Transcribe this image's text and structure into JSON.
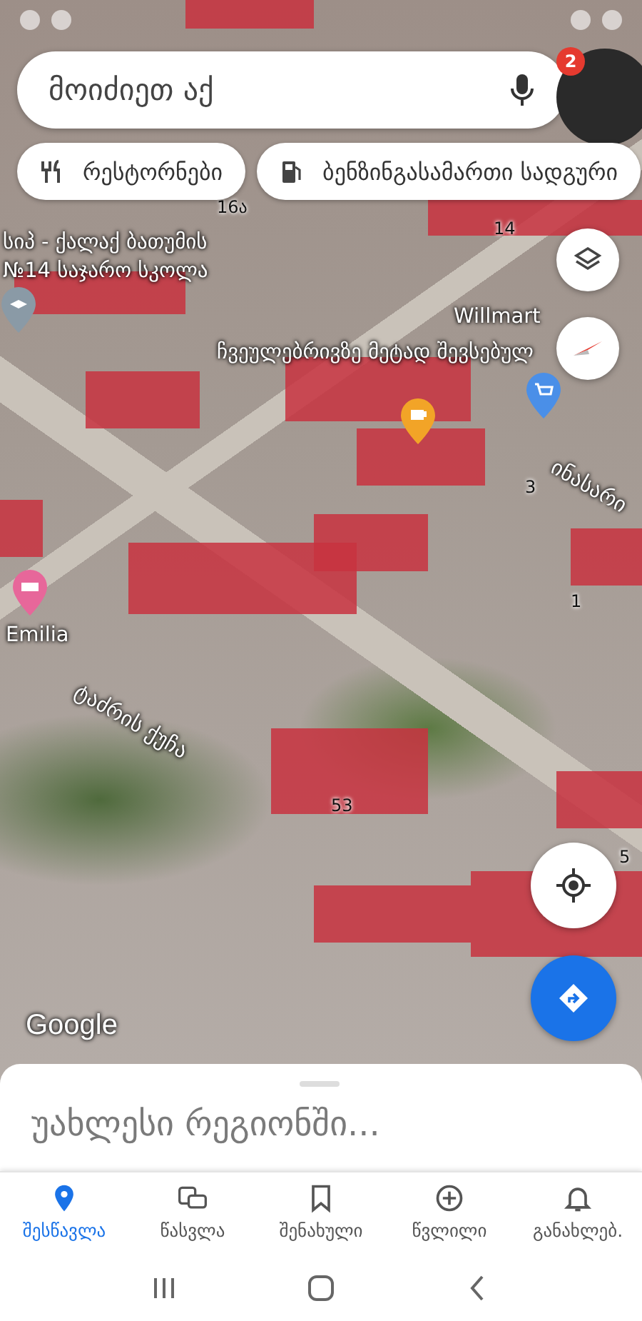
{
  "search": {
    "placeholder": "მოიძიეთ აქ",
    "notification_count": "2"
  },
  "chips": [
    {
      "label": "რესტორნები",
      "kind": "restaurant"
    },
    {
      "label": "ბენზინგასამართი სადგური",
      "kind": "gas"
    }
  ],
  "map_labels": [
    {
      "text": "16ა",
      "kind": "number"
    },
    {
      "text": "14",
      "kind": "number"
    },
    {
      "text": "სიპ - ქალაქ ბათუმის",
      "kind": "place"
    },
    {
      "text": "№14 საჯარო სკოლა",
      "kind": "place"
    },
    {
      "text": "Willmart",
      "kind": "place"
    },
    {
      "text": "ჩვეულებრივზე მეტად შევსებულ",
      "kind": "place"
    },
    {
      "text": "ინასარი",
      "kind": "street"
    },
    {
      "text": "3",
      "kind": "number"
    },
    {
      "text": "1",
      "kind": "number"
    },
    {
      "text": "Emilia",
      "kind": "place"
    },
    {
      "text": "ტაძრის ქუჩა",
      "kind": "street"
    },
    {
      "text": "53",
      "kind": "number"
    },
    {
      "text": "5",
      "kind": "number"
    }
  ],
  "pins": [
    {
      "kind": "school",
      "color": "#8a9aa6"
    },
    {
      "kind": "cafe",
      "color": "#f2a427"
    },
    {
      "kind": "shop",
      "color": "#4a8fe8"
    },
    {
      "kind": "hotel",
      "color": "#e7679a"
    }
  ],
  "map_credit": "Google",
  "sheet": {
    "title": "უახლესი რეგიონში..."
  },
  "nav": [
    {
      "label": "შესწავლა",
      "kind": "explore",
      "selected": true
    },
    {
      "label": "წასვლა",
      "kind": "go",
      "selected": false
    },
    {
      "label": "შენახული",
      "kind": "saved",
      "selected": false
    },
    {
      "label": "წვლილი",
      "kind": "contribute",
      "selected": false
    },
    {
      "label": "განახლებ.",
      "kind": "updates",
      "selected": false
    }
  ]
}
